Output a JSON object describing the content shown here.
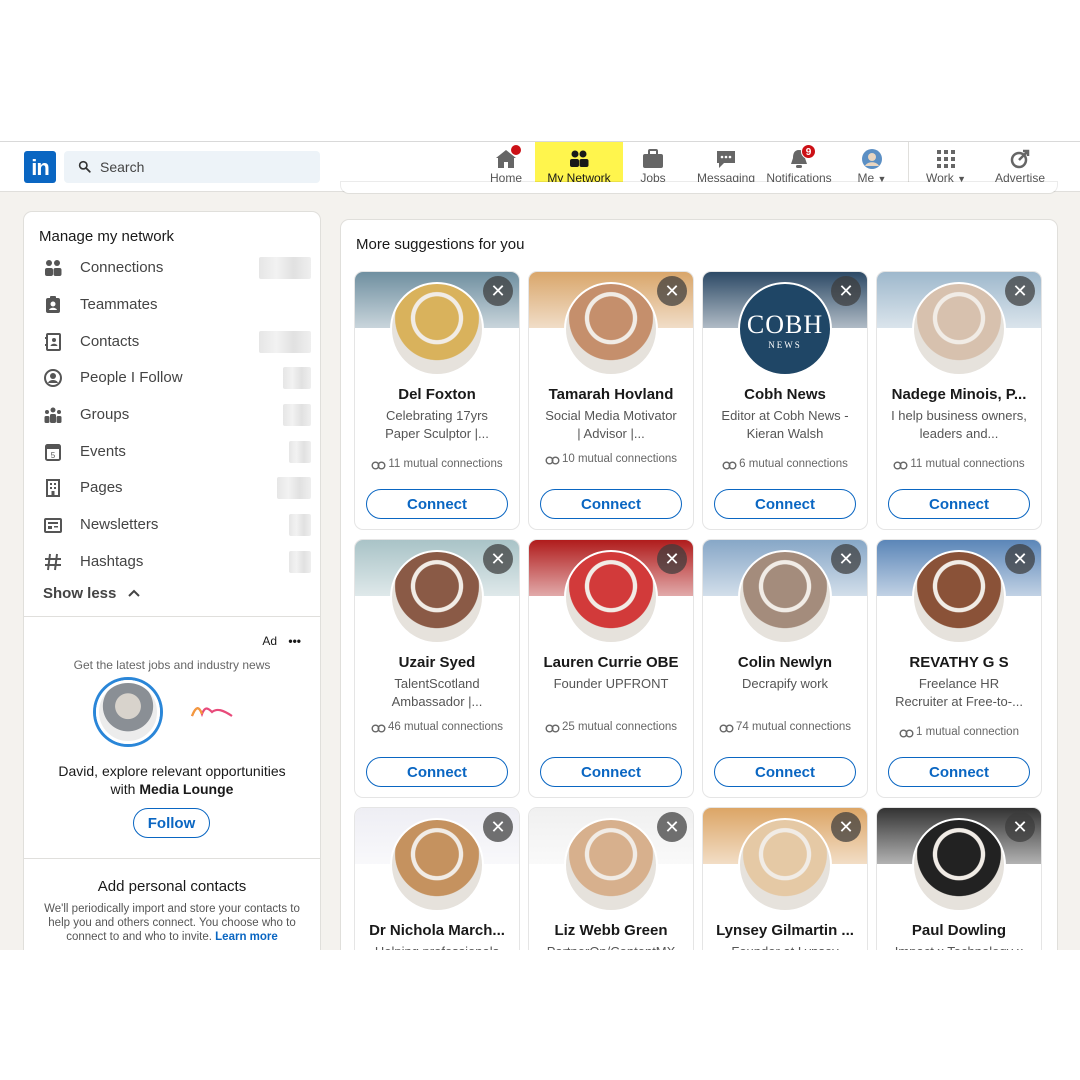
{
  "nav": {
    "logo": "in",
    "search_placeholder": "Search",
    "items": [
      {
        "label": "Home",
        "icon": "home-icon",
        "badge": ""
      },
      {
        "label": "My Network",
        "icon": "my-network-icon",
        "badge": ""
      },
      {
        "label": "Jobs",
        "icon": "briefcase-icon",
        "badge": ""
      },
      {
        "label": "Messaging",
        "icon": "messaging-icon",
        "badge": ""
      },
      {
        "label": "Notifications",
        "icon": "bell-icon",
        "badge": "9"
      },
      {
        "label": "Me",
        "icon": "avatar-icon",
        "badge": ""
      },
      {
        "label": "Work",
        "icon": "grid-icon",
        "badge": ""
      },
      {
        "label": "Advertise",
        "icon": "advertise-icon",
        "badge": ""
      }
    ]
  },
  "sidebar": {
    "title": "Manage my network",
    "items": [
      {
        "label": "Connections",
        "icon": "people-icon"
      },
      {
        "label": "Teammates",
        "icon": "badge-icon"
      },
      {
        "label": "Contacts",
        "icon": "contacts-book-icon"
      },
      {
        "label": "People I Follow",
        "icon": "person-follow-icon"
      },
      {
        "label": "Groups",
        "icon": "groups-icon"
      },
      {
        "label": "Events",
        "icon": "calendar-icon"
      },
      {
        "label": "Pages",
        "icon": "building-icon"
      },
      {
        "label": "Newsletters",
        "icon": "newsletter-icon"
      },
      {
        "label": "Hashtags",
        "icon": "hashtag-icon"
      }
    ],
    "show_less": "Show less",
    "ad": {
      "label": "Ad",
      "subtitle": "Get the latest jobs and industry news",
      "text_line1": "David, explore relevant opportunities",
      "text_prefix": "with ",
      "text_company": "Media Lounge",
      "follow_label": "Follow"
    },
    "contacts": {
      "title": "Add personal contacts",
      "text": "We'll periodically import and store your contacts to help you and others connect. You choose who to connect to and who to invite.",
      "link": "Learn more"
    }
  },
  "main": {
    "title": "More suggestions for you",
    "connect_label": "Connect",
    "cards": [
      {
        "name": "Del Foxton",
        "desc": "Celebrating 17yrs Paper Sculptor |...",
        "mutual": "11 mutual connections",
        "banner": "#6f8fa0",
        "photo": "#d9b25c"
      },
      {
        "name": "Tamarah Hovland",
        "desc": "Social Media Motivator | Advisor |...",
        "mutual": "10 mutual connections",
        "banner": "#d9a66b",
        "photo": "#c58f6c"
      },
      {
        "name": "Cobh News",
        "desc": "Editor at Cobh News - Kieran Walsh",
        "mutual": "6 mutual connections",
        "banner": "#2d4a66",
        "photo": "#1f4666",
        "logo_text": "COBH",
        "logo_sub": "NEWS"
      },
      {
        "name": "Nadege Minois, P...",
        "desc": "I help business owners, leaders and...",
        "mutual": "11 mutual connections",
        "banner": "#9eb8cc",
        "photo": "#d7c1ae"
      },
      {
        "name": "Uzair Syed",
        "desc": "TalentScotland Ambassador |...",
        "mutual": "46 mutual connections",
        "banner": "#a9c3c7",
        "photo": "#8a5a46"
      },
      {
        "name": "Lauren Currie OBE",
        "desc": "Founder UPFRONT",
        "mutual": "25 mutual connections",
        "banner": "#b01c1c",
        "photo": "#d23a3a"
      },
      {
        "name": "Colin Newlyn",
        "desc": "Decrapify work",
        "mutual": "74 mutual connections",
        "banner": "#87a7c7",
        "photo": "#a48c7c"
      },
      {
        "name": "REVATHY G S",
        "desc": "Freelance HR Recruiter at Free-to-...",
        "mutual": "1 mutual connection",
        "banner": "#5b86b8",
        "photo": "#8a5238"
      },
      {
        "name": "Dr Nichola March...",
        "desc": "Helping professionals",
        "mutual": "",
        "banner": "#eeeef4",
        "photo": "#c5925f"
      },
      {
        "name": "Liz Webb Green",
        "desc": "PartnerOn/ContentMX",
        "mutual": "",
        "banner": "#f0f0f0",
        "photo": "#d7b08d"
      },
      {
        "name": "Lynsey Gilmartin ...",
        "desc": "Founder at Lynsey",
        "mutual": "",
        "banner": "#dca566",
        "photo": "#e5c9a5"
      },
      {
        "name": "Paul Dowling",
        "desc": "Impact x Technology x",
        "mutual": "",
        "banner": "#333333",
        "photo": "#222222"
      }
    ]
  },
  "colors": {
    "brand": "#0a66c2",
    "highlight": "#fff54d",
    "badge": "#cc1016"
  }
}
